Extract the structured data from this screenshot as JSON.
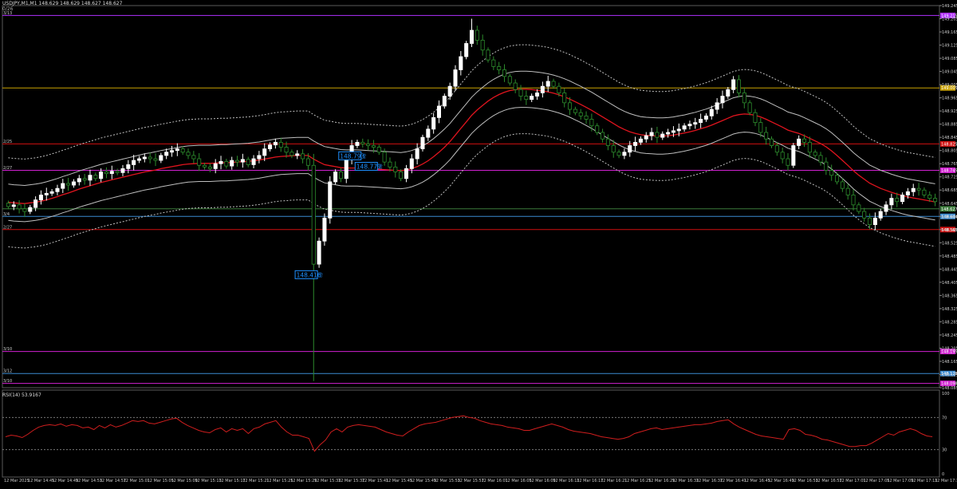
{
  "header": {
    "symbol_line": "USDJPY,M1,M1  148.629 148.629 148.627 148.627",
    "sub_line": "0/26"
  },
  "rsi_label": "RSI(14) 53.9167",
  "colors": {
    "background": "#000000",
    "bull": "#ffffff",
    "bear": "#2d8c2d",
    "ma": "#e0141e",
    "band_inner": "#bfbfbf",
    "band_outer": "#bfbfbf",
    "rsi": "#d01e1e",
    "grid": "#3a3a3a",
    "buy_arrow": "#1e90ff"
  },
  "chart_data": {
    "type": "candlestick",
    "symbol": "USDJPY",
    "timeframe": "M1",
    "ylim": [
      148.085,
      149.245
    ],
    "price_ticks": [
      "149.245",
      "149.205",
      "149.165",
      "149.125",
      "149.085",
      "149.045",
      "149.005",
      "148.965",
      "148.925",
      "148.885",
      "148.845",
      "148.805",
      "148.765",
      "148.725",
      "148.685",
      "148.645",
      "148.605",
      "148.565",
      "148.525",
      "148.485",
      "148.445",
      "148.405",
      "148.365",
      "148.325",
      "148.285",
      "148.245",
      "148.205",
      "148.165",
      "148.125",
      "148.085"
    ],
    "time_ticks": [
      "12 Mar 2025",
      "12 Mar 14:45",
      "12 Mar 14:49",
      "12 Mar 14:53",
      "12 Mar 14:57",
      "12 Mar 15:01",
      "12 Mar 15:05",
      "12 Mar 15:09",
      "12 Mar 15:13",
      "12 Mar 15:17",
      "12 Mar 15:21",
      "12 Mar 15:25",
      "12 Mar 15:29",
      "12 Mar 15:33",
      "12 Mar 15:37",
      "12 Mar 15:41",
      "12 Mar 15:45",
      "12 Mar 15:49",
      "12 Mar 15:53",
      "12 Mar 15:57",
      "12 Mar 16:01",
      "12 Mar 16:05",
      "12 Mar 16:09",
      "12 Mar 16:13",
      "12 Mar 16:17",
      "12 Mar 16:21",
      "12 Mar 16:25",
      "12 Mar 16:29",
      "12 Mar 16:33",
      "12 Mar 16:37",
      "12 Mar 16:41",
      "12 Mar 16:45",
      "12 Mar 16:49",
      "12 Mar 16:53",
      "12 Mar 16:57",
      "12 Mar 17:01",
      "12 Mar 17:05",
      "12 Mar 17:09",
      "12 Mar 17:13",
      "12 Mar 17:16"
    ],
    "level_lines": [
      {
        "label": "3/13",
        "price": 149.215,
        "color": "#b030ff",
        "tag": "149.215"
      },
      {
        "label": "",
        "price": 148.995,
        "color": "#c8a000",
        "tag": "149.005"
      },
      {
        "label": "2/25",
        "price": 148.825,
        "color": "#d01010",
        "tag": "148.825"
      },
      {
        "label": "2/27",
        "price": 148.745,
        "color": "#d020d0",
        "tag": "148.745"
      },
      {
        "label": "",
        "price": 148.628,
        "color": "#3a7a3a",
        "tag": "148.627"
      },
      {
        "label": "3/4",
        "price": 148.605,
        "color": "#3a8ad0",
        "tag": "148.604"
      },
      {
        "label": "2/27",
        "price": 148.565,
        "color": "#d01010",
        "tag": "148.565"
      },
      {
        "label": "3/10",
        "price": 148.195,
        "color": "#d020d0",
        "tag": "148.195"
      },
      {
        "label": "3/12",
        "price": 148.128,
        "color": "#3a8ad0",
        "tag": "148.128"
      },
      {
        "label": "3/10",
        "price": 148.098,
        "color": "#d020d0",
        "tag": "148.098"
      }
    ],
    "annotations": [
      {
        "text": "148.416",
        "price": 148.428,
        "bar": 57
      },
      {
        "text": "148.793",
        "price": 148.789,
        "bar": 65
      },
      {
        "text": "148.779",
        "price": 148.757,
        "bar": 68
      }
    ],
    "close": [
      148.635,
      148.64,
      148.628,
      148.62,
      148.632,
      148.655,
      148.67,
      148.675,
      148.68,
      148.69,
      148.705,
      148.7,
      148.71,
      148.72,
      148.715,
      148.73,
      148.72,
      148.74,
      148.735,
      148.742,
      148.738,
      148.75,
      148.762,
      148.775,
      148.78,
      148.785,
      148.78,
      148.775,
      148.79,
      148.8,
      148.805,
      148.81,
      148.8,
      148.79,
      148.78,
      148.76,
      148.755,
      148.75,
      148.765,
      148.772,
      148.758,
      148.775,
      148.77,
      148.778,
      148.762,
      148.78,
      148.79,
      148.81,
      148.822,
      148.83,
      148.815,
      148.8,
      148.79,
      148.795,
      148.78,
      148.76,
      148.46,
      148.53,
      148.6,
      148.71,
      148.74,
      148.72,
      148.78,
      148.82,
      148.83,
      148.825,
      148.82,
      148.815,
      148.8,
      148.77,
      148.755,
      148.74,
      148.72,
      148.75,
      148.78,
      148.81,
      148.845,
      148.87,
      148.905,
      148.94,
      148.97,
      149.0,
      149.05,
      149.09,
      149.13,
      149.17,
      149.14,
      149.11,
      149.08,
      149.06,
      149.05,
      149.03,
      149.01,
      148.99,
      148.97,
      148.96,
      148.97,
      148.98,
      149.0,
      149.015,
      149.0,
      148.98,
      148.95,
      148.93,
      148.92,
      148.91,
      148.9,
      148.88,
      148.86,
      148.84,
      148.82,
      148.8,
      148.79,
      148.8,
      148.82,
      148.83,
      148.84,
      148.85,
      148.86,
      148.845,
      148.855,
      148.86,
      148.865,
      148.87,
      148.88,
      148.885,
      148.89,
      148.9,
      148.91,
      148.93,
      148.95,
      148.97,
      148.99,
      149.02,
      148.98,
      148.95,
      148.92,
      148.89,
      148.86,
      148.84,
      148.82,
      148.8,
      148.78,
      148.76,
      148.82,
      148.84,
      148.83,
      148.8,
      148.79,
      148.77,
      148.745,
      148.73,
      148.71,
      148.69,
      148.67,
      148.64,
      148.62,
      148.6,
      148.58,
      148.6,
      148.62,
      148.64,
      148.66,
      148.65,
      148.67,
      148.68,
      148.69,
      148.685,
      148.67,
      148.66,
      148.65
    ],
    "ma": [
      148.648,
      148.646,
      148.645,
      148.644,
      148.646,
      148.648,
      148.651,
      148.655,
      148.66,
      148.665,
      148.671,
      148.676,
      148.682,
      148.688,
      148.693,
      148.698,
      148.703,
      148.708,
      148.712,
      148.716,
      148.72,
      148.724,
      148.728,
      148.732,
      148.736,
      148.74,
      148.743,
      148.746,
      148.75,
      148.753,
      148.756,
      148.759,
      148.762,
      148.764,
      148.765,
      148.766,
      148.766,
      148.766,
      148.767,
      148.768,
      148.768,
      148.769,
      148.77,
      148.771,
      148.772,
      148.774,
      148.776,
      148.779,
      148.782,
      148.785,
      148.787,
      148.788,
      148.789,
      148.79,
      148.79,
      148.79,
      148.779,
      148.77,
      148.762,
      148.759,
      148.756,
      148.753,
      148.752,
      148.752,
      148.752,
      148.751,
      148.75,
      148.749,
      148.748,
      148.747,
      148.746,
      148.745,
      148.744,
      148.746,
      148.75,
      148.756,
      148.764,
      148.774,
      148.786,
      148.8,
      148.815,
      148.832,
      148.852,
      148.872,
      148.892,
      148.912,
      148.928,
      148.942,
      148.955,
      148.966,
      148.975,
      148.982,
      148.987,
      148.99,
      148.991,
      148.991,
      148.99,
      148.988,
      148.986,
      148.983,
      148.979,
      148.974,
      148.968,
      148.961,
      148.953,
      148.945,
      148.936,
      148.927,
      148.917,
      148.907,
      148.897,
      148.887,
      148.877,
      148.869,
      148.862,
      148.857,
      148.853,
      148.851,
      148.85,
      148.849,
      148.849,
      148.85,
      148.852,
      148.855,
      148.858,
      148.862,
      148.866,
      148.871,
      148.876,
      148.882,
      148.889,
      148.896,
      148.903,
      148.91,
      148.914,
      148.916,
      148.915,
      148.912,
      148.907,
      148.9,
      148.892,
      148.884,
      148.876,
      148.867,
      148.862,
      148.857,
      148.85,
      148.842,
      148.834,
      148.826,
      148.816,
      148.804,
      148.79,
      148.775,
      148.76,
      148.744,
      148.73,
      148.718,
      148.706,
      148.698,
      148.69,
      148.684,
      148.678,
      148.673,
      148.668,
      148.664,
      148.661,
      148.658,
      148.655,
      148.652,
      148.649
    ]
  },
  "rsi_data": {
    "ylim": [
      0,
      100
    ],
    "ticks": [
      "100",
      "70",
      "30",
      "0"
    ],
    "levels": [
      70,
      30
    ],
    "values": [
      46,
      48,
      47,
      45,
      49,
      54,
      58,
      60,
      61,
      60,
      62,
      59,
      61,
      60,
      57,
      58,
      55,
      60,
      57,
      61,
      58,
      60,
      63,
      66,
      65,
      66,
      63,
      62,
      64,
      66,
      68,
      69,
      64,
      60,
      57,
      54,
      52,
      51,
      55,
      57,
      52,
      56,
      54,
      56,
      50,
      56,
      58,
      62,
      64,
      66,
      58,
      52,
      48,
      48,
      46,
      44,
      28,
      36,
      42,
      52,
      56,
      52,
      58,
      60,
      61,
      60,
      59,
      58,
      55,
      52,
      50,
      48,
      47,
      52,
      56,
      60,
      62,
      63,
      64,
      66,
      68,
      70,
      71,
      72,
      70,
      69,
      66,
      64,
      62,
      61,
      60,
      58,
      57,
      56,
      54,
      54,
      56,
      58,
      60,
      62,
      60,
      58,
      55,
      53,
      52,
      51,
      50,
      48,
      46,
      45,
      44,
      43,
      44,
      46,
      50,
      52,
      54,
      56,
      57,
      55,
      56,
      57,
      58,
      59,
      60,
      61,
      61,
      62,
      63,
      65,
      66,
      67,
      62,
      58,
      55,
      52,
      49,
      47,
      46,
      45,
      44,
      43,
      55,
      56,
      54,
      49,
      48,
      46,
      43,
      42,
      40,
      38,
      36,
      34,
      34,
      35,
      35,
      38,
      42,
      46,
      50,
      48,
      52,
      54,
      56,
      54,
      50,
      47,
      46
    ]
  }
}
